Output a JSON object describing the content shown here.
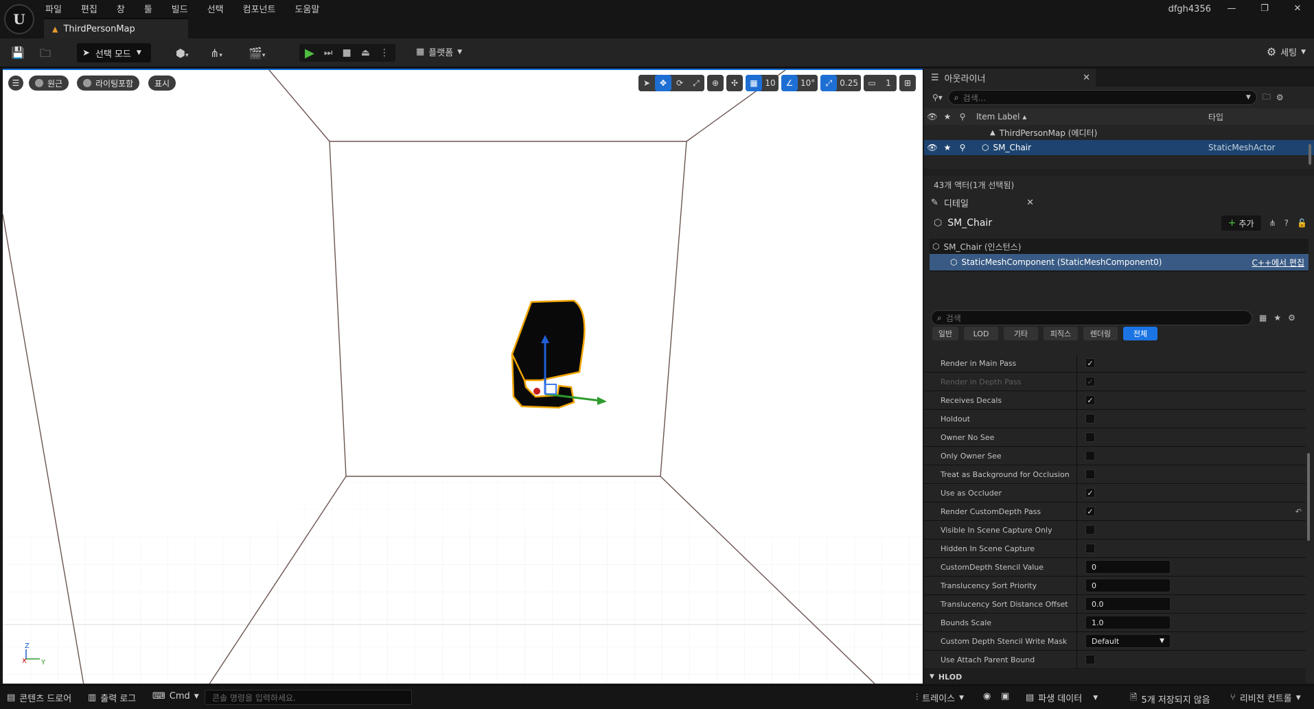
{
  "app": {
    "logo": "U",
    "menu": [
      "파일",
      "편집",
      "창",
      "툴",
      "빌드",
      "선택",
      "컴포넌트",
      "도움말"
    ],
    "document_tab": "ThirdPersonMap",
    "user": "dfgh4356"
  },
  "toolbar": {
    "select_mode": "선택 모드",
    "platform": "플랫폼",
    "settings": "세팅"
  },
  "viewport": {
    "perspective_label": "원근",
    "lighting_label": "라이팅포함",
    "show_label": "표시",
    "grid_snap": "10",
    "rotation_snap": "10°",
    "scale_snap": "0.25",
    "camera_speed": "1",
    "axis": {
      "z": "Z",
      "x": "X",
      "y": "Y"
    }
  },
  "outliner": {
    "tab_label": "아웃라이너",
    "search_placeholder": "검색...",
    "col_label": "Item Label",
    "col_type": "타입",
    "rows": [
      {
        "label": "ThirdPersonMap (에디터)",
        "type": ""
      },
      {
        "label": "SM_Chair",
        "type": "StaticMeshActor"
      }
    ],
    "status": "43개 액터(1개 선택됨)"
  },
  "details": {
    "tab_label": "디테일",
    "actor_name": "SM_Chair",
    "add_button": "추가",
    "instance_label": "SM_Chair (인스턴스)",
    "component_label": "StaticMeshComponent (StaticMeshComponent0)",
    "edit_cpp": "C++에서 편집",
    "search_placeholder": "검색",
    "filter_tabs": [
      "일반",
      "LOD",
      "기타",
      "피직스",
      "렌더링",
      "전체"
    ],
    "properties": [
      {
        "name": "Render in Main Pass",
        "kind": "check",
        "checked": true
      },
      {
        "name": "Render in Depth Pass",
        "kind": "check",
        "checked": true,
        "disabled": true
      },
      {
        "name": "Receives Decals",
        "kind": "check",
        "checked": true
      },
      {
        "name": "Holdout",
        "kind": "check",
        "checked": false
      },
      {
        "name": "Owner No See",
        "kind": "check",
        "checked": false
      },
      {
        "name": "Only Owner See",
        "kind": "check",
        "checked": false
      },
      {
        "name": "Treat as Background for Occlusion",
        "kind": "check",
        "checked": false
      },
      {
        "name": "Use as Occluder",
        "kind": "check",
        "checked": true
      },
      {
        "name": "Render CustomDepth Pass",
        "kind": "check",
        "checked": true,
        "reset": true
      },
      {
        "name": "Visible In Scene Capture Only",
        "kind": "check",
        "checked": false
      },
      {
        "name": "Hidden In Scene Capture",
        "kind": "check",
        "checked": false
      },
      {
        "name": "CustomDepth Stencil Value",
        "kind": "number",
        "value": "0"
      },
      {
        "name": "Translucency Sort Priority",
        "kind": "number",
        "value": "0"
      },
      {
        "name": "Translucency Sort Distance Offset",
        "kind": "number",
        "value": "0.0"
      },
      {
        "name": "Bounds Scale",
        "kind": "number",
        "value": "1.0"
      },
      {
        "name": "Custom Depth Stencil Write Mask",
        "kind": "select",
        "value": "Default"
      },
      {
        "name": "Use Attach Parent Bound",
        "kind": "check",
        "checked": false
      }
    ],
    "section_hlod": "HLOD"
  },
  "statusbar": {
    "content_drawer": "콘텐츠 드로어",
    "output_log": "출력 로그",
    "cmd": "Cmd",
    "cmd_placeholder": "콘솔 명령을 입력하세요.",
    "trace": "트레이스",
    "derived_data": "파생 데이터",
    "unsaved": "5개 저장되지 않음",
    "revision_control": "리비전 컨트롤"
  },
  "colors": {
    "accent": "#1b74e4",
    "selection": "#1d4470",
    "play_green": "#4fbd41",
    "selection_outline": "#f0a400"
  }
}
